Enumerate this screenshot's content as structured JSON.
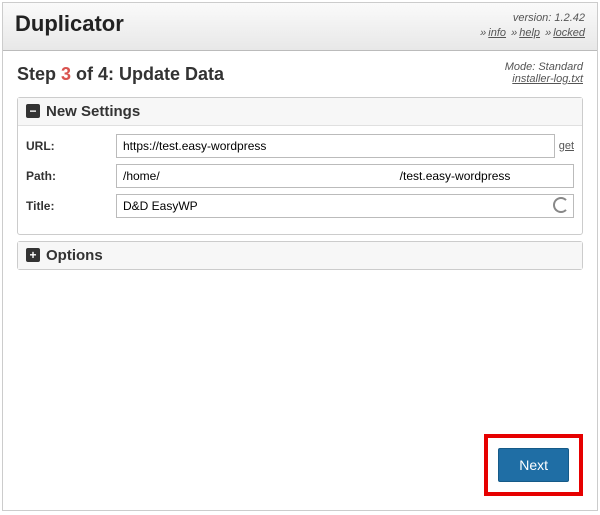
{
  "header": {
    "app_title": "Duplicator",
    "version_label": "version: 1.2.42",
    "link_info": "info",
    "link_help": "help",
    "link_locked": "locked"
  },
  "step": {
    "prefix": "Step ",
    "current": "3",
    "suffix": " of 4: Update Data",
    "mode_label": "Mode: Standard",
    "log_link": "installer-log.txt"
  },
  "panels": {
    "new_settings": {
      "title": "New Settings",
      "fields": {
        "url_label": "URL:",
        "url_value": "https://test.easy-wordpress",
        "get_label": "get",
        "path_label": "Path:",
        "path_prefix": "/home/",
        "path_suffix": "/test.easy-wordpress",
        "title_label": "Title:",
        "title_value": "D&D EasyWP"
      }
    },
    "options": {
      "title": "Options"
    }
  },
  "buttons": {
    "next": "Next"
  }
}
